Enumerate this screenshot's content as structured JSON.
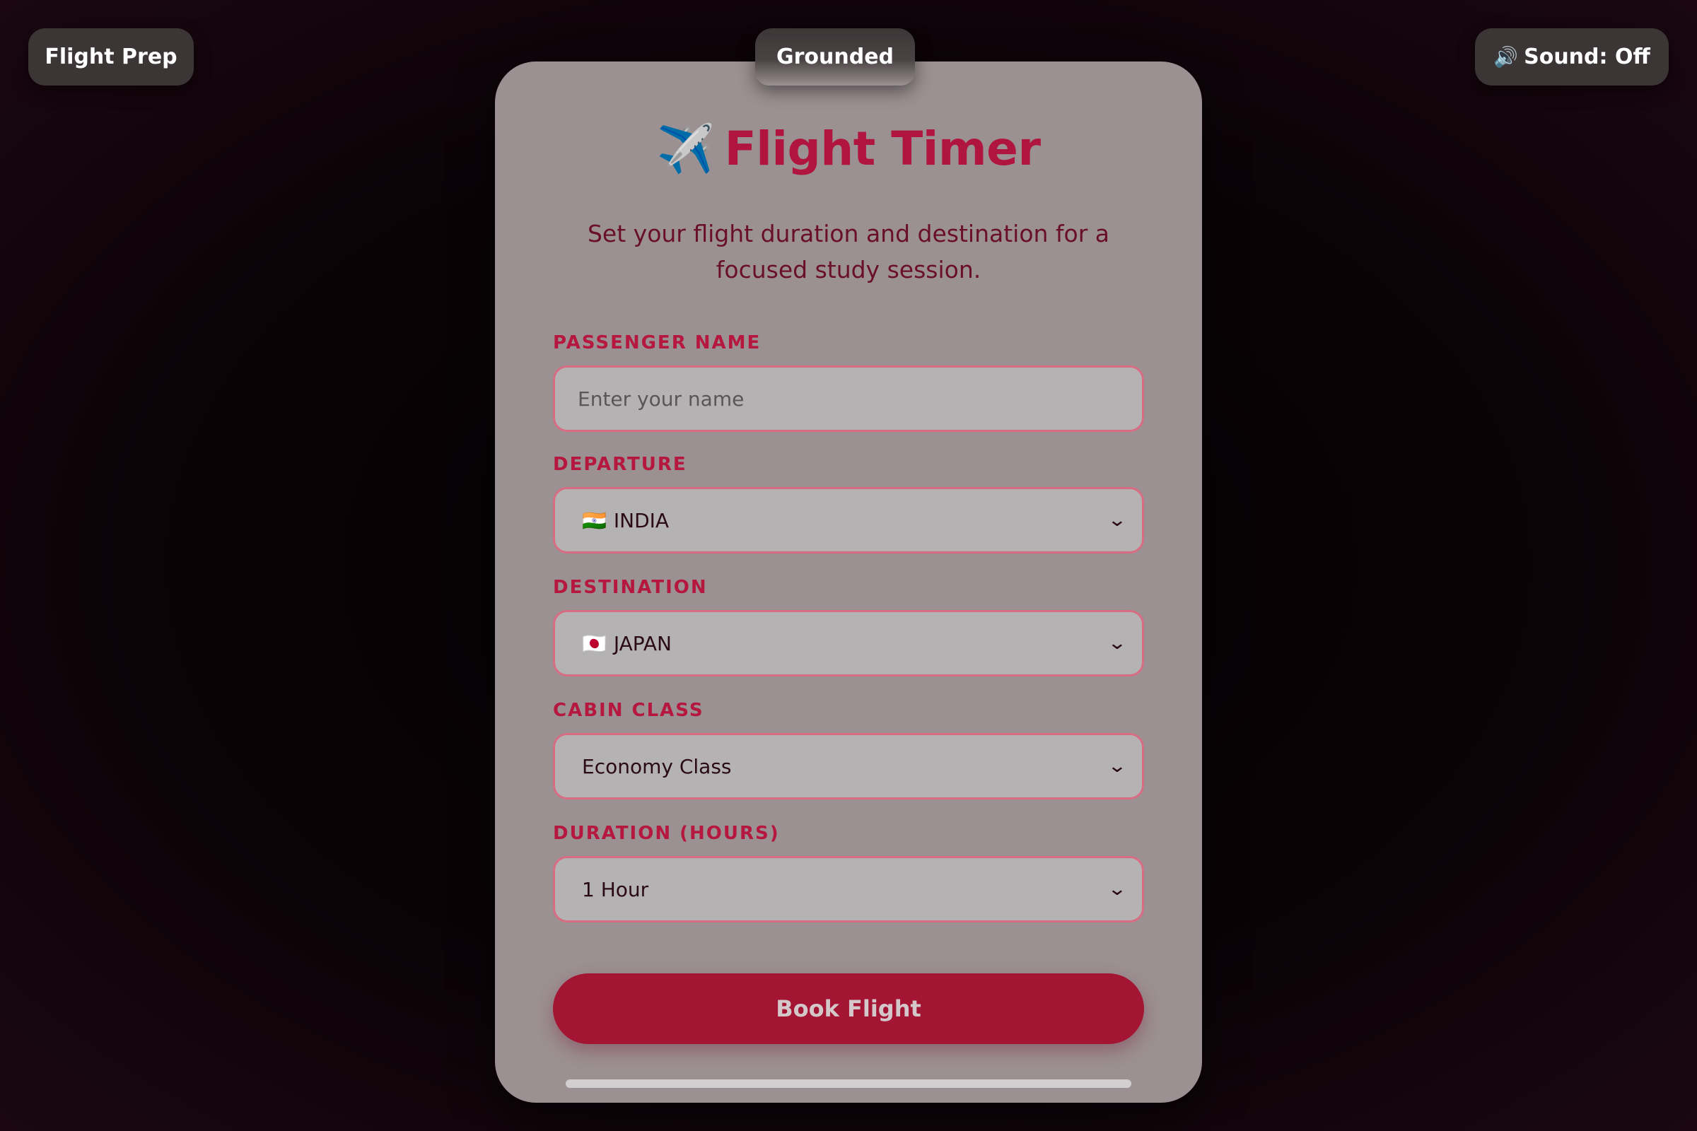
{
  "header": {
    "left_button": "Flight Prep",
    "center_status": "Grounded",
    "sound_icon": "🔊",
    "sound_button": "Sound: Off"
  },
  "card": {
    "plane_icon": "✈️",
    "title": "Flight Timer",
    "subtitle": "Set your flight duration and destination for a focused study session.",
    "fields": {
      "passenger_name": {
        "label": "PASSENGER NAME",
        "placeholder": "Enter your name",
        "value": ""
      },
      "departure": {
        "label": "DEPARTURE",
        "flag": "🇮🇳",
        "value": "INDIA"
      },
      "destination": {
        "label": "DESTINATION",
        "flag": "🇯🇵",
        "value": "JAPAN"
      },
      "cabin_class": {
        "label": "CABIN CLASS",
        "value": "Economy Class"
      },
      "duration": {
        "label": "DURATION (HOURS)",
        "value": "1 Hour"
      }
    },
    "book_button": "Book Flight"
  },
  "icons": {
    "chevron": "chevron-down-icon",
    "plane": "airplane-icon",
    "sound": "speaker-icon"
  },
  "colors": {
    "accent": "#b0153f",
    "button": "#a31533",
    "card_bg": "#9b9092",
    "field_bg": "#b4b2b3",
    "field_border": "#d86c83"
  }
}
